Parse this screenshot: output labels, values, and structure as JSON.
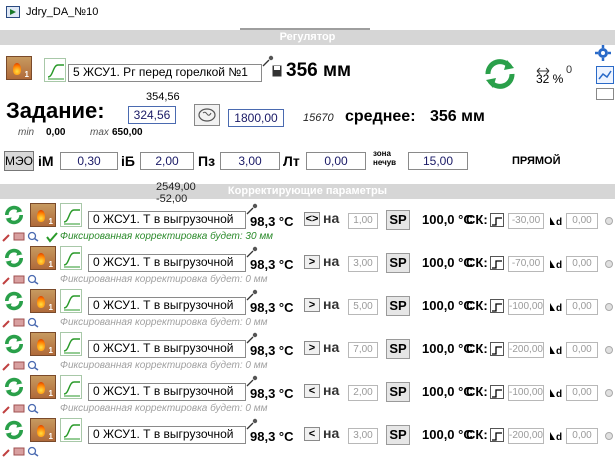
{
  "window": {
    "title": "Jdry_DA_№10"
  },
  "regulator": {
    "header": "Регулятор",
    "source_label": "5 ЖСУ1. Рг перед горелкой №1",
    "measured_value": "356 мм",
    "percent_value": "32 %",
    "percent_superscript": "0",
    "setpoint_label": "Задание:",
    "setpoint_top": "354,56",
    "setpoint_value": "324,56",
    "setpoint_limit": "1800,00",
    "code": "15670",
    "average_label": "среднее:",
    "average_value": "356 мм",
    "min_label": "min",
    "min_value": "0,00",
    "max_label": "max",
    "max_value": "650,00"
  },
  "params": {
    "mode_button": "МЭО",
    "im_label": "iM",
    "im_value": "0,30",
    "ib_label": "iБ",
    "ib_value": "2,00",
    "pz_label": "Пз",
    "pz_value": "3,00",
    "lt_label": "Лт",
    "lt_value": "0,00",
    "zone_label_1": "зона",
    "zone_label_2": "нечув",
    "zone_value": "15,00",
    "direction": "ПРЯМОЙ"
  },
  "correction": {
    "header": "Корректирующие параметры",
    "top_value": "2549,00",
    "bottom_value": "-52,00",
    "na_label": "на",
    "sp_label": "SP",
    "sp_value": "100,0 °C",
    "sk_label": "СК:",
    "rows": [
      {
        "source": "0 ЖСУ1. Т в выгрузочной",
        "temp": "98,3 °C",
        "cmp": "<>",
        "na_value": "1,00",
        "sk_value": "-30,00",
        "d_value": "0,00",
        "note": "Фиксированная корректировка будет: 30 мм",
        "note_active": true
      },
      {
        "source": "0 ЖСУ1. Т в выгрузочной",
        "temp": "98,3 °C",
        "cmp": ">",
        "na_value": "3,00",
        "sk_value": "-70,00",
        "d_value": "0,00",
        "note": "Фиксированная корректировка будет: 0 мм",
        "note_active": false
      },
      {
        "source": "0 ЖСУ1. Т в выгрузочной",
        "temp": "98,3 °C",
        "cmp": ">",
        "na_value": "5,00",
        "sk_value": "-100,00",
        "d_value": "0,00",
        "note": "Фиксированная корректировка будет: 0 мм",
        "note_active": false
      },
      {
        "source": "0 ЖСУ1. Т в выгрузочной",
        "temp": "98,3 °C",
        "cmp": ">",
        "na_value": "7,00",
        "sk_value": "-200,00",
        "d_value": "0,00",
        "note": "Фиксированная корректировка будет: 0 мм",
        "note_active": false
      },
      {
        "source": "0 ЖСУ1. Т в выгрузочной",
        "temp": "98,3 °C",
        "cmp": "<",
        "na_value": "2,00",
        "sk_value": "-100,00",
        "d_value": "0,00",
        "note": "Фиксированная корректировка будет: 0 мм",
        "note_active": false
      },
      {
        "source": "0 ЖСУ1. Т в выгрузочной",
        "temp": "98,3 °C",
        "cmp": "<",
        "na_value": "3,00",
        "sk_value": "-200,00",
        "d_value": "0,00",
        "note": "",
        "note_active": false
      }
    ]
  },
  "colors": {
    "accent_green": "#2a8a2a",
    "header_bar": "#d6d6d6",
    "value_text": "#1a1a66"
  }
}
